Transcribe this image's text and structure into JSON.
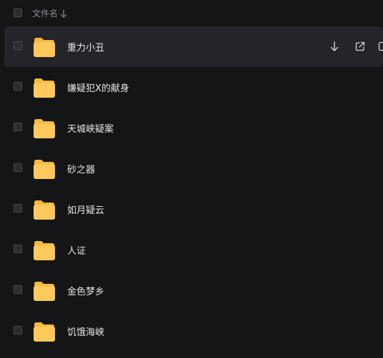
{
  "header": {
    "column_label": "文件名",
    "sort_icon": "arrow-down-icon"
  },
  "rows": [
    {
      "name": "重力小丑",
      "icon": "folder-icon",
      "hover": true
    },
    {
      "name": "嫌疑犯X的献身",
      "icon": "folder-icon"
    },
    {
      "name": "天城峡疑案",
      "icon": "folder-icon"
    },
    {
      "name": "砂之器",
      "icon": "folder-icon"
    },
    {
      "name": "如月疑云",
      "icon": "folder-icon"
    },
    {
      "name": "人证",
      "icon": "folder-icon"
    },
    {
      "name": "金色梦乡",
      "icon": "folder-icon"
    },
    {
      "name": "饥饿海峡",
      "icon": "folder-icon"
    }
  ],
  "row_actions": [
    "download-icon",
    "share-icon",
    "more-icon"
  ],
  "colors": {
    "background": "#141517",
    "hover_row": "#23252a",
    "folder_front": "#ffc95c",
    "folder_back": "#f5b843",
    "text": "#e6e7ea",
    "muted_text": "#8a8d93"
  }
}
